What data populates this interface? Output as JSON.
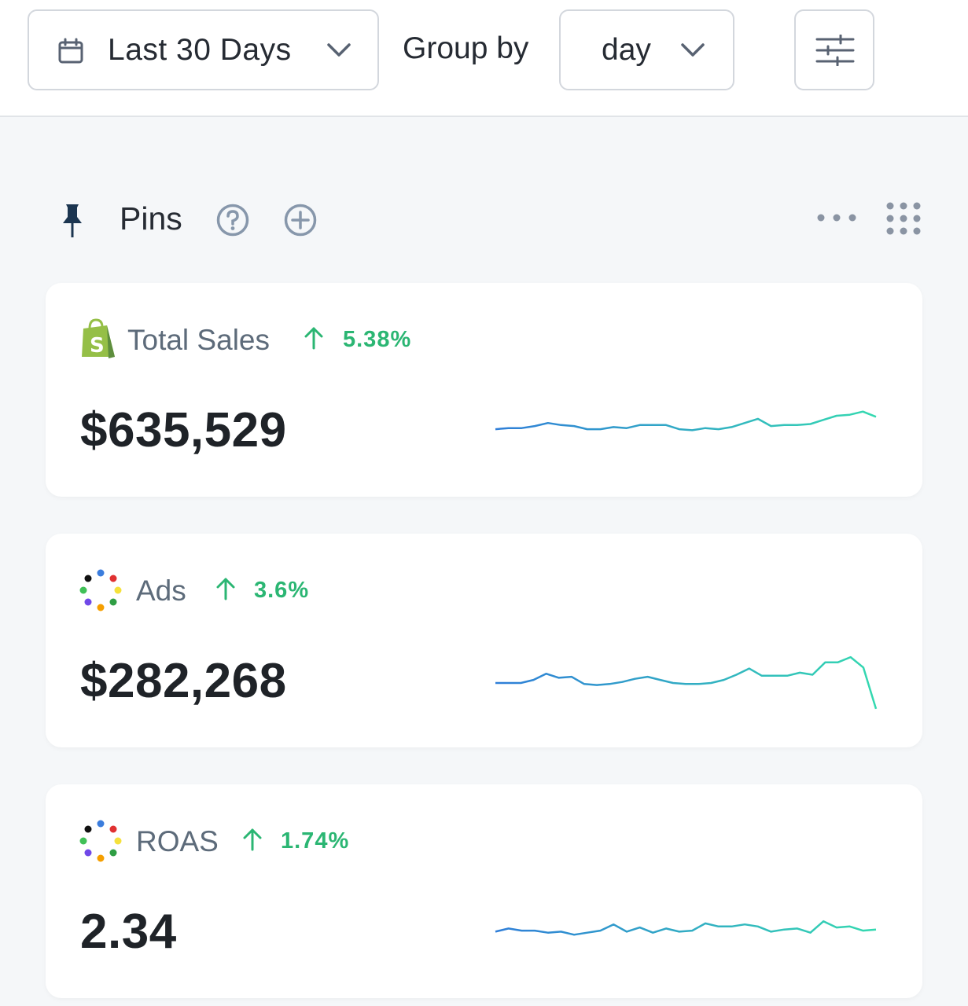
{
  "toolbar": {
    "date_range_label": "Last 30 Days",
    "group_by_label": "Group by",
    "group_by_value": "day"
  },
  "pins": {
    "title": "Pins"
  },
  "cards": [
    {
      "name": "Total Sales",
      "change": "5.38%",
      "value": "$635,529",
      "trend": "up",
      "sparkline": [
        38,
        39,
        39,
        41,
        44,
        42,
        41,
        38,
        38,
        40,
        39,
        42,
        42,
        42,
        38,
        37,
        39,
        38,
        40,
        44,
        48,
        41,
        42,
        42,
        43,
        47,
        51,
        52,
        55,
        50
      ]
    },
    {
      "name": "Ads",
      "change": "3.6%",
      "value": "$282,268",
      "trend": "up",
      "sparkline": [
        35,
        35,
        35,
        38,
        44,
        40,
        41,
        34,
        33,
        34,
        36,
        39,
        41,
        38,
        35,
        34,
        34,
        35,
        38,
        43,
        49,
        42,
        42,
        42,
        45,
        43,
        55,
        55,
        60,
        50,
        10
      ]
    },
    {
      "name": "ROAS",
      "change": "1.74%",
      "value": "2.34",
      "trend": "up",
      "sparkline": [
        37,
        40,
        38,
        38,
        36,
        37,
        34,
        36,
        38,
        44,
        37,
        41,
        36,
        40,
        37,
        38,
        45,
        42,
        42,
        44,
        42,
        37,
        39,
        40,
        36,
        47,
        41,
        42,
        38,
        39
      ]
    }
  ],
  "colors": {
    "accent_green": "#2bb673",
    "spark_start": "#2f7ed8",
    "spark_end": "#34d9b0"
  },
  "icons": [
    "calendar-icon",
    "chevron-down-icon",
    "sliders-icon",
    "pin-icon",
    "help-icon",
    "add-circle-icon",
    "more-horizontal-icon",
    "grid-dots-icon",
    "shopify-icon",
    "ads-dots-icon",
    "arrow-up-icon"
  ]
}
